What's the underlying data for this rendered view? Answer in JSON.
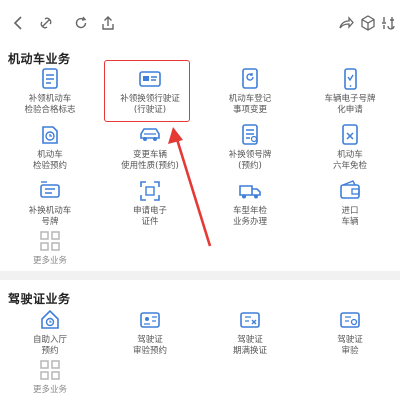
{
  "toolbar": {
    "left_icons": [
      "back-icon",
      "link-icon",
      "refresh-icon",
      "share-icon"
    ],
    "right_icons": [
      "forward-share-icon",
      "cube-icon",
      "settings-icon"
    ]
  },
  "sections": [
    {
      "title": "机动车业务",
      "tiles": [
        {
          "label": "补领机动车\n检验合格标志",
          "icon": "document-icon"
        },
        {
          "label": "补领换领行驶证\n(行驶证)",
          "icon": "card-icon"
        },
        {
          "label": "机动车登记\n事项变更",
          "icon": "refresh-doc-icon"
        },
        {
          "label": "车辆电子号牌\n化申请",
          "icon": "phone-icon"
        },
        {
          "label": "机动车\n检验预约",
          "icon": "clock-doc-icon"
        },
        {
          "label": "变更车辆\n使用性质(预约)",
          "icon": "car-icon"
        },
        {
          "label": "补换领号牌\n(预约)",
          "icon": "list-doc-icon"
        },
        {
          "label": "机动车\n六年免检",
          "icon": "check-doc-icon"
        },
        {
          "label": "补换机动车\n号牌",
          "icon": "plate-icon"
        },
        {
          "label": "申请电子\n证件",
          "icon": "scan-icon"
        },
        {
          "label": "车型年检\n业务办理",
          "icon": "truck-icon"
        },
        {
          "label": "进口\n车辆",
          "icon": "wallet-icon"
        },
        {
          "label": "更多业务",
          "icon": "grid-icon",
          "more": true
        }
      ]
    },
    {
      "title": "驾驶证业务",
      "tiles": [
        {
          "label": "自助入厅\n预约",
          "icon": "user-clock-icon"
        },
        {
          "label": "驾驶证\n审验预约",
          "icon": "license-icon"
        },
        {
          "label": "驾驶证\n期满换证",
          "icon": "license-x-icon"
        },
        {
          "label": "驾驶证\n审验",
          "icon": "license-check-icon"
        },
        {
          "label": "更多业务",
          "icon": "grid-icon",
          "more": true
        }
      ]
    }
  ],
  "colors": {
    "accent": "#3f7fd9",
    "more_gray": "#b7b7b7",
    "highlight_red": "#e53935"
  }
}
